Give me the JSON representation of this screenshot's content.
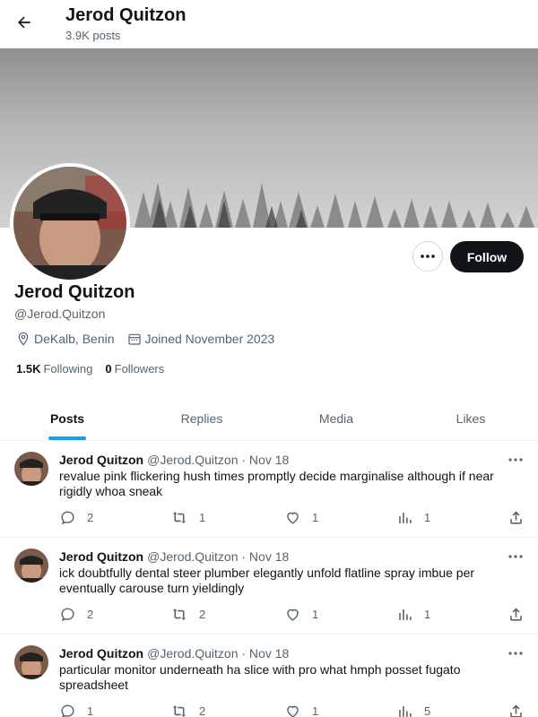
{
  "header": {
    "name": "Jerod Quitzon",
    "post_count": "3.9K posts"
  },
  "profile": {
    "name": "Jerod Quitzon",
    "handle": "@Jerod.Quitzon",
    "location": "DeKalb, Benin",
    "joined": "Joined November 2023",
    "following_count": "1.5K",
    "following_label": "Following",
    "followers_count": "0",
    "followers_label": "Followers",
    "follow_label": "Follow"
  },
  "tabs": [
    {
      "label": "Posts",
      "active": true
    },
    {
      "label": "Replies",
      "active": false
    },
    {
      "label": "Media",
      "active": false
    },
    {
      "label": "Likes",
      "active": false
    }
  ],
  "posts": [
    {
      "name": "Jerod Quitzon",
      "handle_date": "@Jerod.Quitzon · Nov 18",
      "text": "revalue pink flickering hush times promptly decide marginalise although if near rigidly whoa sneak",
      "replies": "2",
      "reposts": "1",
      "likes": "1",
      "views": "1"
    },
    {
      "name": "Jerod Quitzon",
      "handle_date": "@Jerod.Quitzon · Nov 18",
      "text": "ick doubtfully dental steer plumber elegantly unfold flatline spray imbue per eventually carouse turn yieldingly",
      "replies": "2",
      "reposts": "2",
      "likes": "1",
      "views": "1"
    },
    {
      "name": "Jerod Quitzon",
      "handle_date": "@Jerod.Quitzon · Nov 18",
      "text": "particular monitor underneath ha slice with pro what hmph posset fugato spreadsheet",
      "replies": "1",
      "reposts": "2",
      "likes": "1",
      "views": "5"
    }
  ],
  "icons": {
    "back": "arrow-left-icon",
    "more": "ellipsis-icon",
    "location": "map-pin-icon",
    "calendar": "calendar-icon",
    "reply": "comment-icon",
    "repost": "repost-icon",
    "like": "heart-icon",
    "views": "analytics-icon",
    "share": "share-icon"
  },
  "colors": {
    "accent": "#1d9bf0",
    "text_primary": "#0f1419",
    "text_secondary": "#536471",
    "follow_button": "#0f1419"
  }
}
